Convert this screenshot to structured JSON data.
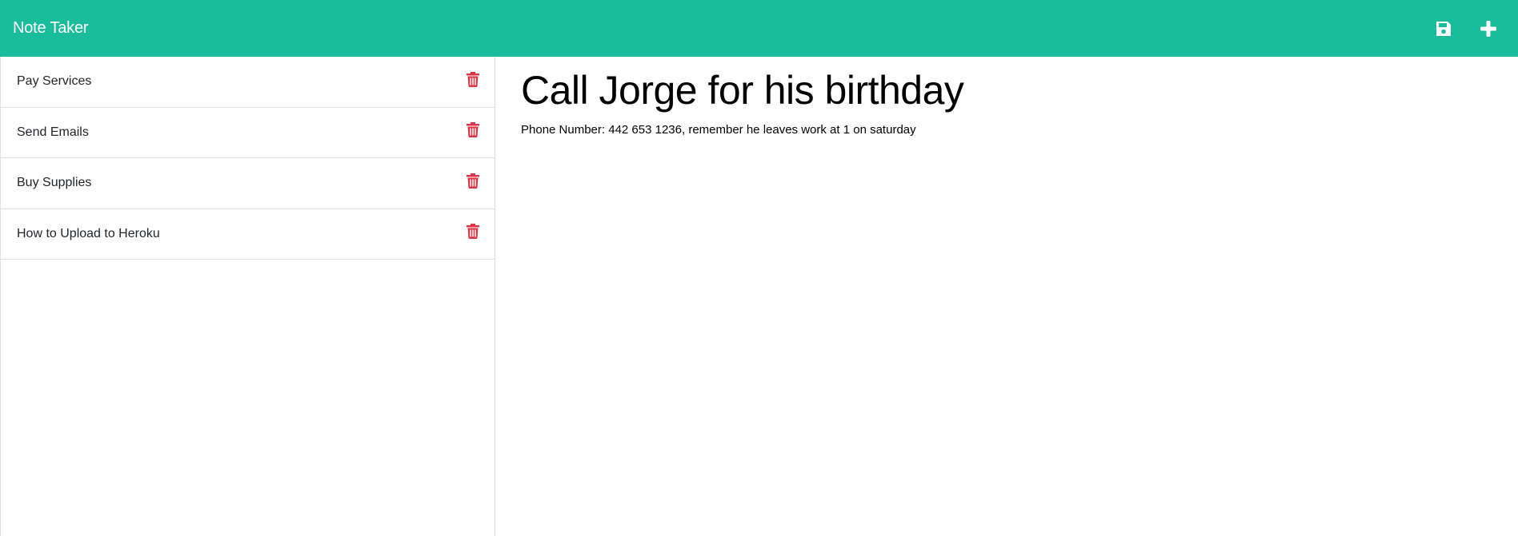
{
  "app": {
    "title": "Note Taker"
  },
  "toolbar": {
    "save_icon": "save-icon",
    "add_icon": "plus-icon"
  },
  "colors": {
    "navbar": "#1abc9c",
    "delete_icon": "#dc3545"
  },
  "notes": [
    {
      "title": "Pay Services"
    },
    {
      "title": "Send Emails"
    },
    {
      "title": "Buy Supplies"
    },
    {
      "title": "How to Upload to Heroku"
    }
  ],
  "active_note": {
    "title": "Call Jorge for his birthday",
    "text": "Phone Number: 442 653 1236, remember he leaves work at 1 on saturday"
  }
}
